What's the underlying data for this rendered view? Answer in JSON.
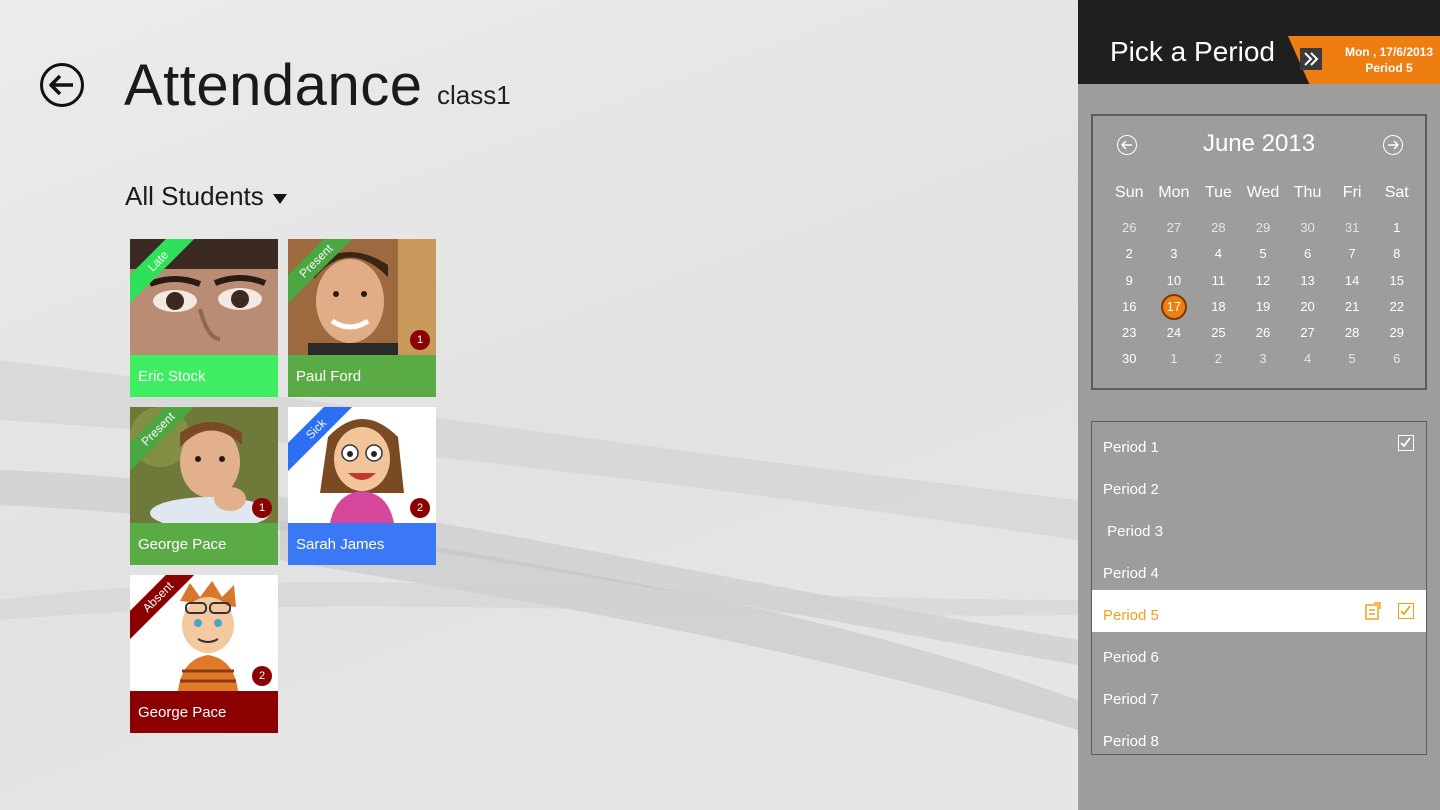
{
  "header": {
    "title": "Attendance",
    "class_name": "class1"
  },
  "filter": {
    "label": "All Students"
  },
  "students": [
    {
      "name": "Eric Stock",
      "status": "Late",
      "status_color": "#2fe05a",
      "bar_color": "#3dee60",
      "badge": ""
    },
    {
      "name": "Paul Ford",
      "status": "Present",
      "status_color": "#4aa742",
      "bar_color": "#5aab45",
      "badge": "1"
    },
    {
      "name": "George Pace",
      "status": "Present",
      "status_color": "#4aa742",
      "bar_color": "#5aab45",
      "badge": "1"
    },
    {
      "name": "Sarah James",
      "status": "Sick",
      "status_color": "#2c6ff2",
      "bar_color": "#3b78f5",
      "badge": "2"
    },
    {
      "name": "George Pace",
      "status": "Absent",
      "status_color": "#8b0000",
      "bar_color": "#8b0000",
      "badge": "2"
    }
  ],
  "side_panel": {
    "title": "Pick a Period",
    "date_line1": "Mon , 17/6/2013",
    "date_line2": "Period 5",
    "accent_color": "#ee7d12"
  },
  "calendar": {
    "month_label": "June 2013",
    "weekdays": [
      "Sun",
      "Mon",
      "Tue",
      "Wed",
      "Thu",
      "Fri",
      "Sat"
    ],
    "selected_day": "17",
    "weeks": [
      [
        "26",
        "27",
        "28",
        "29",
        "30",
        "31",
        "1"
      ],
      [
        "2",
        "3",
        "4",
        "5",
        "6",
        "7",
        "8"
      ],
      [
        "9",
        "10",
        "11",
        "12",
        "13",
        "14",
        "15"
      ],
      [
        "16",
        "17",
        "18",
        "19",
        "20",
        "21",
        "22"
      ],
      [
        "23",
        "24",
        "25",
        "26",
        "27",
        "28",
        "29"
      ],
      [
        "30",
        "1",
        "2",
        "3",
        "4",
        "5",
        "6"
      ]
    ]
  },
  "periods": [
    {
      "label": "Period 1",
      "checked": true,
      "active": false
    },
    {
      "label": "Period 2",
      "checked": false,
      "active": false
    },
    {
      "label": " Period 3",
      "checked": false,
      "active": false
    },
    {
      "label": "Period 4",
      "checked": false,
      "active": false
    },
    {
      "label": "Period 5",
      "checked": true,
      "active": true
    },
    {
      "label": "Period 6",
      "checked": false,
      "active": false
    },
    {
      "label": "Period 7",
      "checked": false,
      "active": false
    },
    {
      "label": "Period 8",
      "checked": false,
      "active": false
    }
  ]
}
